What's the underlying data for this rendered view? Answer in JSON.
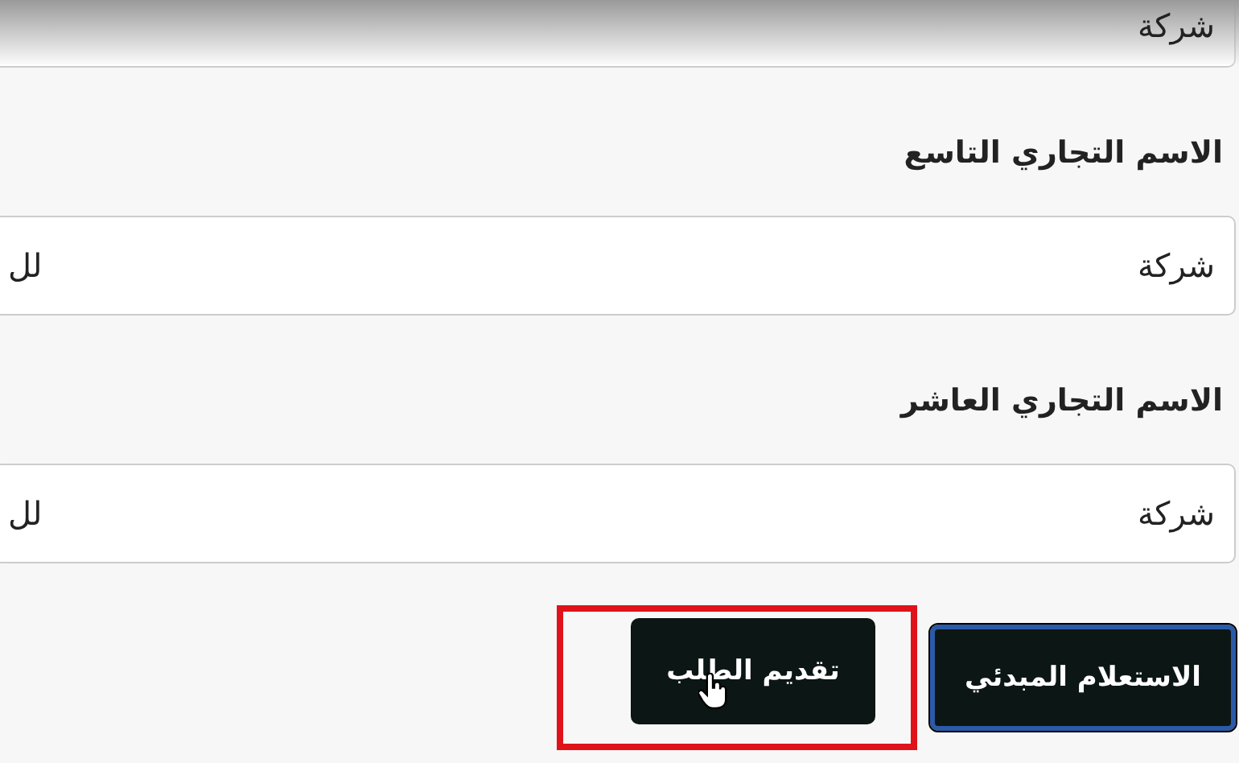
{
  "fields": [
    {
      "value": "شركة"
    },
    {
      "label": "الاسم التجاري التاسع",
      "value": "شركة",
      "value_end": "لل"
    },
    {
      "label": "الاسم التجاري العاشر",
      "value": "شركة",
      "value_end": "لل"
    }
  ],
  "buttons": [
    {
      "label": "الاستعلام المبدئي",
      "kind": "outlined"
    },
    {
      "label": "تقديم الطلب",
      "kind": "highlighted"
    }
  ]
}
